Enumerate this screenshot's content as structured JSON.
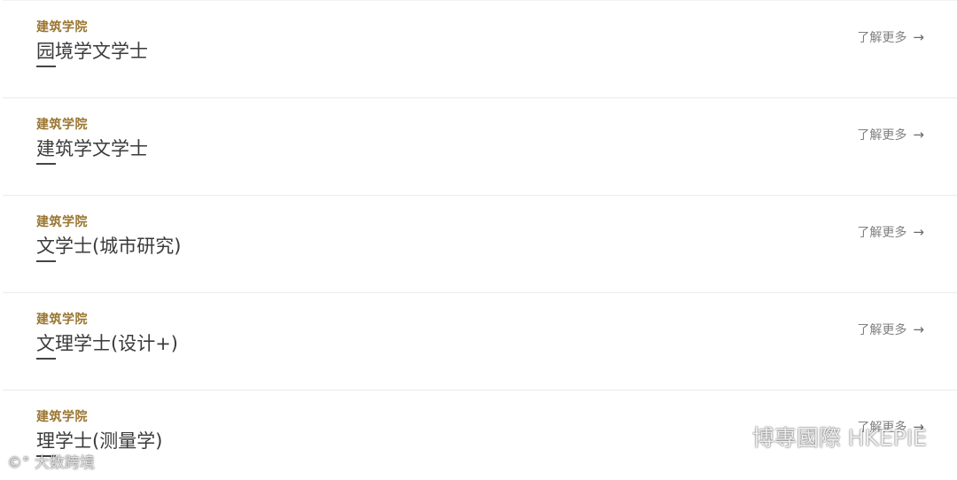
{
  "programs": [
    {
      "school": "建筑学院",
      "title": "园境学文学士",
      "more_label": "了解更多"
    },
    {
      "school": "建筑学院",
      "title": "建筑学文学士",
      "more_label": "了解更多"
    },
    {
      "school": "建筑学院",
      "title": "文学士(城市研究)",
      "more_label": "了解更多"
    },
    {
      "school": "建筑学院",
      "title": "文理学士(设计+)",
      "more_label": "了解更多"
    },
    {
      "school": "建筑学院",
      "title": "理学士(测量学)",
      "more_label": "了解更多"
    }
  ],
  "arrow_glyph": "→",
  "watermarks": {
    "left": "大数跨境",
    "right": "博專國際 HKEPIE"
  },
  "colors": {
    "school": "#9a7630",
    "title": "#3a3a3a",
    "more": "#808080"
  }
}
